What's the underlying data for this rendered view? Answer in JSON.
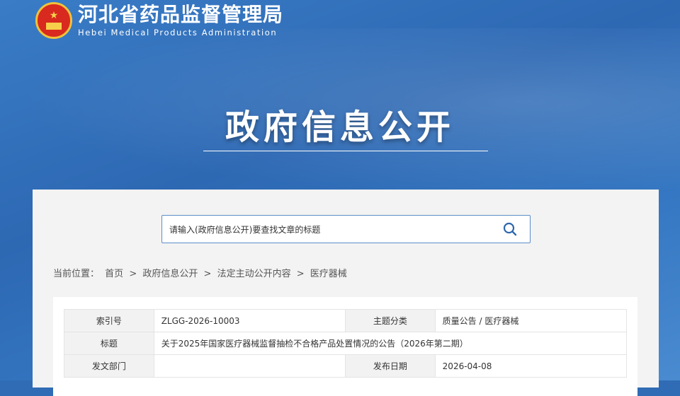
{
  "header": {
    "site_name_cn": "河北省药品监督管理局",
    "site_name_en": "Hebei Medical Products Administration",
    "banner_title": "政府信息公开"
  },
  "search": {
    "placeholder": "请输入(政府信息公开)要查找文章的标题",
    "icon": "search-icon"
  },
  "breadcrumb": {
    "prefix": "当前位置：",
    "items": [
      "首页",
      "政府信息公开",
      "法定主动公开内容",
      "医疗器械"
    ],
    "separator": ">"
  },
  "info_table": {
    "index_label": "索引号",
    "index_value": "ZLGG-2026-10003",
    "topic_label": "主题分类",
    "topic_value": "质量公告 / 医疗器械",
    "title_label": "标题",
    "title_value": "关于2025年国家医疗器械监督抽检不合格产品处置情况的公告（2026年第二期）",
    "dept_label": "发文部门",
    "dept_value": "",
    "date_label": "发布日期",
    "date_value": "2026-04-08"
  }
}
